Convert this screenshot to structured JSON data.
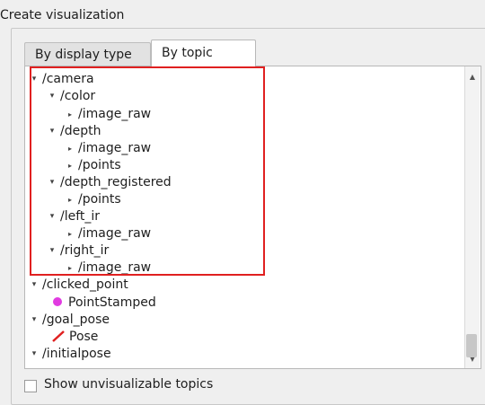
{
  "dialog": {
    "title": "Create visualization"
  },
  "tabs": [
    {
      "label": "By display type",
      "active": false
    },
    {
      "label": "By topic",
      "active": true
    }
  ],
  "tree": [
    {
      "label": "/camera",
      "expanded": true
    },
    {
      "label": "/color",
      "expanded": true
    },
    {
      "label": "/image_raw",
      "expanded": false
    },
    {
      "label": "/depth",
      "expanded": true
    },
    {
      "label": "/image_raw",
      "expanded": false
    },
    {
      "label": "/points",
      "expanded": false
    },
    {
      "label": "/depth_registered",
      "expanded": true
    },
    {
      "label": "/points",
      "expanded": false
    },
    {
      "label": "/left_ir",
      "expanded": true
    },
    {
      "label": "/image_raw",
      "expanded": false
    },
    {
      "label": "/right_ir",
      "expanded": true
    },
    {
      "label": "/image_raw",
      "expanded": false
    },
    {
      "label": "/clicked_point",
      "expanded": true
    },
    {
      "label": "PointStamped",
      "icon": "pink-dot-icon",
      "color": "#e13be1"
    },
    {
      "label": "/goal_pose",
      "expanded": true
    },
    {
      "label": "Pose",
      "icon": "pose-arrow-icon",
      "color": "#e02020"
    },
    {
      "label": "/initialpose",
      "expanded": true
    }
  ],
  "highlight_color": "#e02020",
  "checkbox": {
    "label": "Show unvisualizable topics",
    "checked": false
  }
}
